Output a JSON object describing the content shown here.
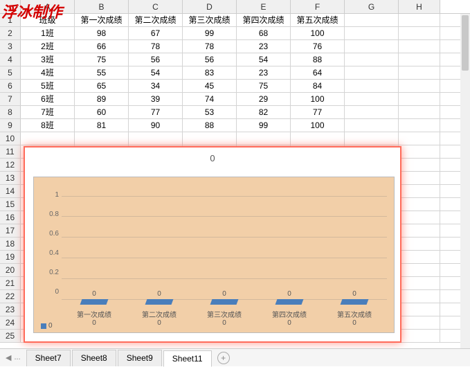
{
  "watermark": "浮冰制作",
  "columns": [
    "A",
    "B",
    "C",
    "D",
    "E",
    "F",
    "G",
    "H"
  ],
  "row_numbers": [
    1,
    2,
    3,
    4,
    5,
    6,
    7,
    8,
    9,
    10,
    11,
    12,
    13,
    14,
    15,
    16,
    17,
    18,
    19,
    20,
    21,
    22,
    23,
    24,
    25
  ],
  "table": {
    "header": {
      "A": "班级",
      "B": "第一次成绩",
      "C": "第二次成绩",
      "D": "第三次成绩",
      "E": "第四次成绩",
      "F": "第五次成绩"
    },
    "rows": [
      {
        "A": "1班",
        "B": "98",
        "C": "67",
        "D": "99",
        "E": "68",
        "F": "100"
      },
      {
        "A": "2班",
        "B": "66",
        "C": "78",
        "D": "78",
        "E": "23",
        "F": "76"
      },
      {
        "A": "3班",
        "B": "75",
        "C": "56",
        "D": "56",
        "E": "54",
        "F": "88"
      },
      {
        "A": "4班",
        "B": "55",
        "C": "54",
        "D": "83",
        "E": "23",
        "F": "64"
      },
      {
        "A": "5班",
        "B": "65",
        "C": "34",
        "D": "45",
        "E": "75",
        "F": "84"
      },
      {
        "A": "6班",
        "B": "89",
        "C": "39",
        "D": "74",
        "E": "29",
        "F": "100"
      },
      {
        "A": "7班",
        "B": "60",
        "C": "77",
        "D": "53",
        "E": "82",
        "F": "77"
      },
      {
        "A": "8班",
        "B": "81",
        "C": "90",
        "D": "88",
        "E": "99",
        "F": "100"
      }
    ]
  },
  "chart_data": {
    "type": "bar",
    "title": "0",
    "categories": [
      "第一次成绩",
      "第二次成绩",
      "第三次成绩",
      "第四次成绩",
      "第五次成绩"
    ],
    "values": [
      0,
      0,
      0,
      0,
      0
    ],
    "data_labels": [
      "0",
      "0",
      "0",
      "0",
      "0"
    ],
    "value_labels": [
      "0",
      "0",
      "0",
      "0",
      "0"
    ],
    "y_ticks": [
      "1",
      "0.8",
      "0.6",
      "0.4",
      "0.2",
      "0"
    ],
    "ylim": [
      0,
      1
    ],
    "legend": "0",
    "plot_bg": "#f2cfa8",
    "series_color": "#4a7ebb"
  },
  "tabs": {
    "nav_prev_all": "⏮",
    "nav_prev": "◀",
    "ellipsis": "...",
    "items": [
      "Sheet7",
      "Sheet8",
      "Sheet9",
      "Sheet11"
    ],
    "active": "Sheet11",
    "add": "+"
  }
}
